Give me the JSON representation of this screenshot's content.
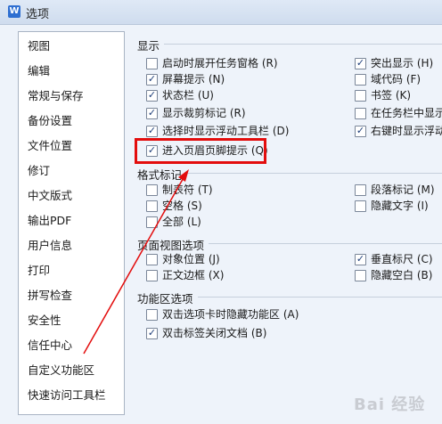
{
  "window": {
    "title": "选项",
    "icon": "wps-w-icon",
    "icon_letter": "W"
  },
  "sidebar": {
    "items": [
      {
        "label": "视图"
      },
      {
        "label": "编辑"
      },
      {
        "label": "常规与保存"
      },
      {
        "label": "备份设置"
      },
      {
        "label": "文件位置"
      },
      {
        "label": "修订"
      },
      {
        "label": "中文版式"
      },
      {
        "label": "输出PDF"
      },
      {
        "label": "用户信息"
      },
      {
        "label": "打印"
      },
      {
        "label": "拼写检查"
      },
      {
        "label": "安全性"
      },
      {
        "label": "信任中心"
      },
      {
        "label": "自定义功能区"
      },
      {
        "label": "快速访问工具栏"
      }
    ]
  },
  "sections": {
    "display": {
      "title": "显示",
      "options": [
        {
          "label": "启动时展开任务窗格 (R)",
          "checked": false
        },
        {
          "label": "屏幕提示 (N)",
          "checked": true
        },
        {
          "label": "状态栏 (U)",
          "checked": true
        },
        {
          "label": "显示裁剪标记 (R)",
          "checked": true
        },
        {
          "label": "选择时显示浮动工具栏 (D)",
          "checked": true
        },
        {
          "label": "进入页眉页脚提示 (Q)",
          "checked": true
        },
        {
          "label": "突出显示 (H)",
          "checked": true
        },
        {
          "label": "域代码 (F)",
          "checked": false
        },
        {
          "label": "书签 (K)",
          "checked": false
        },
        {
          "label": "在任务栏中显示",
          "checked": false
        },
        {
          "label": "右键时显示浮动",
          "checked": true
        }
      ]
    },
    "format_marks": {
      "title": "格式标记",
      "options": [
        {
          "label": "制表符 (T)",
          "checked": false
        },
        {
          "label": "空格 (S)",
          "checked": false
        },
        {
          "label": "全部 (L)",
          "checked": false
        },
        {
          "label": "段落标记 (M)",
          "checked": false
        },
        {
          "label": "隐藏文字 (I)",
          "checked": false
        }
      ]
    },
    "page_view": {
      "title": "页面视图选项",
      "options": [
        {
          "label": "对象位置 (J)",
          "checked": false
        },
        {
          "label": "正文边框 (X)",
          "checked": false
        },
        {
          "label": "垂直标尺 (C)",
          "checked": true
        },
        {
          "label": "隐藏空白 (B)",
          "checked": false
        }
      ]
    },
    "ribbon": {
      "title": "功能区选项",
      "options": [
        {
          "label": "双击选项卡时隐藏功能区 (A)",
          "checked": false
        },
        {
          "label": "双击标签关闭文档 (B)",
          "checked": true
        }
      ]
    }
  },
  "check_mark": "✓",
  "watermark": "Bai 经验",
  "colors": {
    "highlight": "#e30d0d",
    "arrow": "#e30d0d",
    "app_icon": "#2f6fd1"
  }
}
